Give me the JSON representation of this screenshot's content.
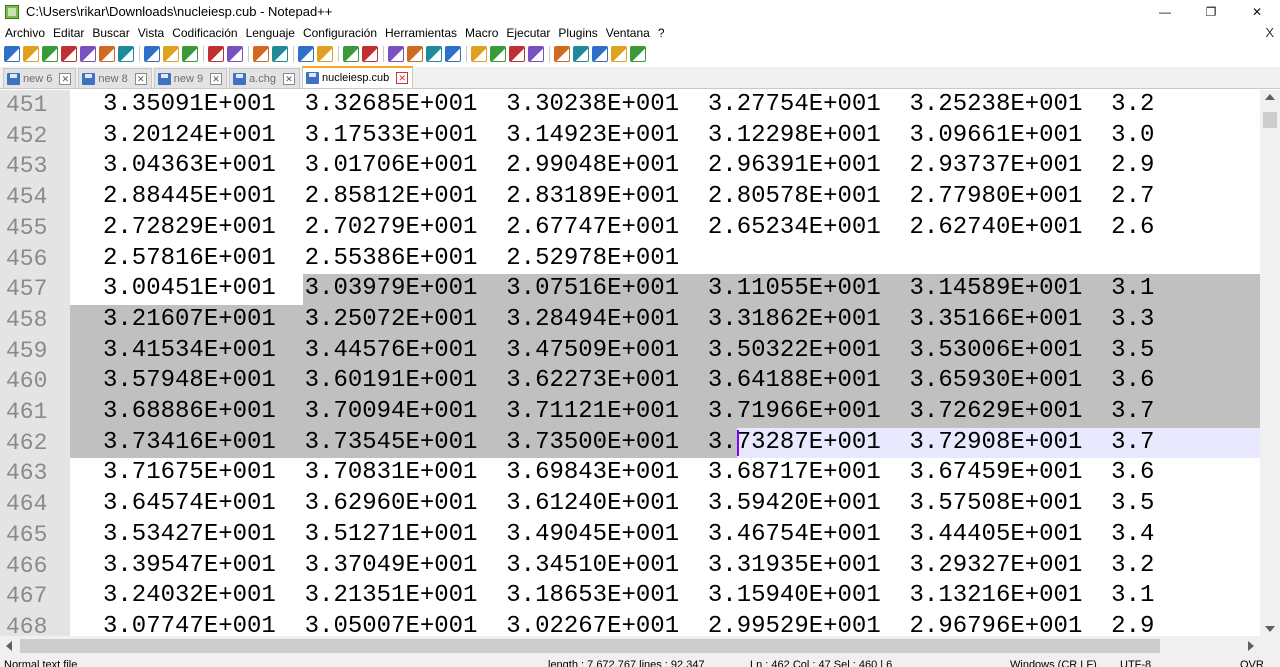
{
  "window": {
    "title": "C:\\Users\\rikar\\Downloads\\nucleiesp.cub - Notepad++",
    "minimize_glyph": "—",
    "maximize_glyph": "❐",
    "close_glyph": "✕"
  },
  "menu": {
    "items": [
      "Archivo",
      "Editar",
      "Buscar",
      "Vista",
      "Codificación",
      "Lenguaje",
      "Configuración",
      "Herramientas",
      "Macro",
      "Ejecutar",
      "Plugins",
      "Ventana",
      "?"
    ],
    "close_glyph": "X"
  },
  "toolbar": {
    "icons": [
      "new-file",
      "open-file",
      "save",
      "save-all",
      "close",
      "close-all",
      "print",
      "cut",
      "copy",
      "paste",
      "undo",
      "redo",
      "find",
      "replace",
      "zoom-in",
      "zoom-out",
      "sync-vertical",
      "sync-horizontal",
      "word-wrap",
      "show-all-chars",
      "indent-guide",
      "define-language",
      "document-map",
      "function-list",
      "folder-workspace",
      "monitoring",
      "record-macro",
      "stop-macro",
      "play-macro",
      "play-macro-multiple",
      "save-macro"
    ],
    "accent_colors": [
      "#2f6fc9",
      "#e0a020",
      "#3a9a3a",
      "#c03030",
      "#7a4fc0",
      "#d06a20",
      "#1e8a9a"
    ]
  },
  "tabs": [
    {
      "label": "new 6",
      "active": false
    },
    {
      "label": "new 8",
      "active": false
    },
    {
      "label": "new 9",
      "active": false
    },
    {
      "label": "a.chg",
      "active": false
    },
    {
      "label": "nucleiesp.cub",
      "active": true
    }
  ],
  "tab_close_glyph": "✕",
  "editor": {
    "selection_color": "#c0c0c0",
    "current_line_color": "#e8e8ff",
    "caret_color": "#8000ff",
    "lines": [
      {
        "n": "451",
        "text": "3.35091E+001  3.32685E+001  3.30238E+001  3.27754E+001  3.25238E+001  3.2"
      },
      {
        "n": "452",
        "text": "3.20124E+001  3.17533E+001  3.14923E+001  3.12298E+001  3.09661E+001  3.0"
      },
      {
        "n": "453",
        "text": "3.04363E+001  3.01706E+001  2.99048E+001  2.96391E+001  2.93737E+001  2.9"
      },
      {
        "n": "454",
        "text": "2.88445E+001  2.85812E+001  2.83189E+001  2.80578E+001  2.77980E+001  2.7"
      },
      {
        "n": "455",
        "text": "2.72829E+001  2.70279E+001  2.67747E+001  2.65234E+001  2.62740E+001  2.6"
      },
      {
        "n": "456",
        "text": "2.57816E+001  2.55386E+001  2.52978E+001"
      },
      {
        "n": "457",
        "text": "3.00451E+001  3.03979E+001  3.07516E+001  3.11055E+001  3.14589E+001  3.1"
      },
      {
        "n": "458",
        "text": "3.21607E+001  3.25072E+001  3.28494E+001  3.31862E+001  3.35166E+001  3.3"
      },
      {
        "n": "459",
        "text": "3.41534E+001  3.44576E+001  3.47509E+001  3.50322E+001  3.53006E+001  3.5"
      },
      {
        "n": "460",
        "text": "3.57948E+001  3.60191E+001  3.62273E+001  3.64188E+001  3.65930E+001  3.6"
      },
      {
        "n": "461",
        "text": "3.68886E+001  3.70094E+001  3.71121E+001  3.71966E+001  3.72629E+001  3.7"
      },
      {
        "n": "462",
        "text": "3.73416E+001  3.73545E+001  3.73500E+001  3.73287E+001  3.72908E+001  3.7"
      },
      {
        "n": "463",
        "text": "3.71675E+001  3.70831E+001  3.69843E+001  3.68717E+001  3.67459E+001  3.6"
      },
      {
        "n": "464",
        "text": "3.64574E+001  3.62960E+001  3.61240E+001  3.59420E+001  3.57508E+001  3.5"
      },
      {
        "n": "465",
        "text": "3.53427E+001  3.51271E+001  3.49045E+001  3.46754E+001  3.44405E+001  3.4"
      },
      {
        "n": "466",
        "text": "3.39547E+001  3.37049E+001  3.34510E+001  3.31935E+001  3.29327E+001  3.2"
      },
      {
        "n": "467",
        "text": "3.24032E+001  3.21351E+001  3.18653E+001  3.15940E+001  3.13216E+001  3.1"
      },
      {
        "n": "468",
        "text": "3.07747E+001  3.05007E+001  3.02267E+001  2.99529E+001  2.96796E+001  2.9"
      }
    ]
  },
  "statusbar": {
    "doc_type": "Normal text file",
    "length_lines": "length : 7,672,767    lines : 92,347",
    "position": "Ln : 462    Col : 47    Sel : 460 | 6",
    "eol": "Windows (CR LF)",
    "encoding": "UTF-8",
    "mode": "OVR"
  }
}
